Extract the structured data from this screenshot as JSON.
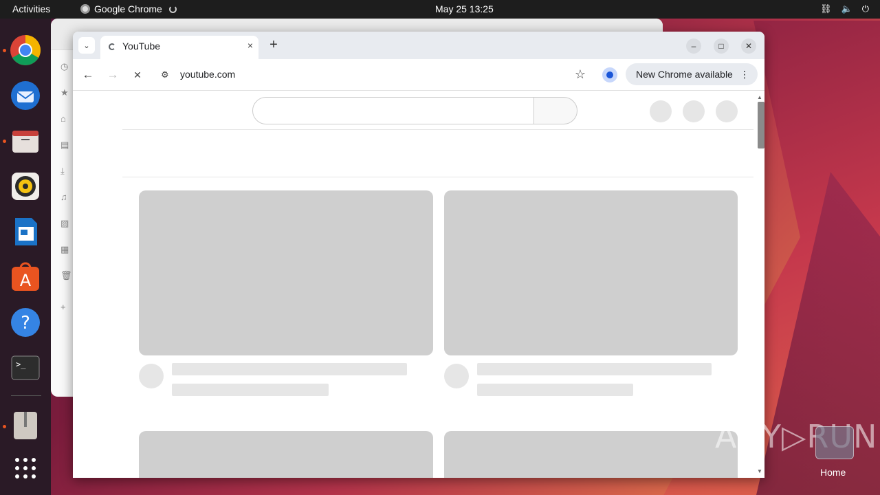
{
  "topbar": {
    "activities": "Activities",
    "app_name": "Google Chrome",
    "clock": "May 25  13:25",
    "tray_icons": [
      "network-icon",
      "volume-icon",
      "power-icon"
    ]
  },
  "dock": {
    "items": [
      "chrome-icon",
      "thunderbird-icon",
      "files-icon",
      "rhythmbox-icon",
      "writer-icon",
      "app-center-icon",
      "help-icon",
      "terminal-icon",
      "archive-icon",
      "show-apps-icon"
    ]
  },
  "chrome": {
    "tab_title": "YouTube",
    "tab_close": "×",
    "new_tab": "+",
    "url": "youtube.com",
    "update_label": "New Chrome available",
    "menu_glyph": "⋮",
    "back_glyph": "←",
    "forward_glyph": "→",
    "stop_glyph": "✕",
    "star_glyph": "☆",
    "minimize_glyph": "–",
    "maximize_glyph": "□",
    "close_glyph": "✕"
  },
  "desktop": {
    "watermark": "ANY▷RUN",
    "home_label": "Home"
  },
  "colors": {
    "topbar": "#1d1d1d",
    "tabstrip": "#e8ebf0",
    "skeleton": "#cfcfcf",
    "accent_dot": "#e95420"
  }
}
